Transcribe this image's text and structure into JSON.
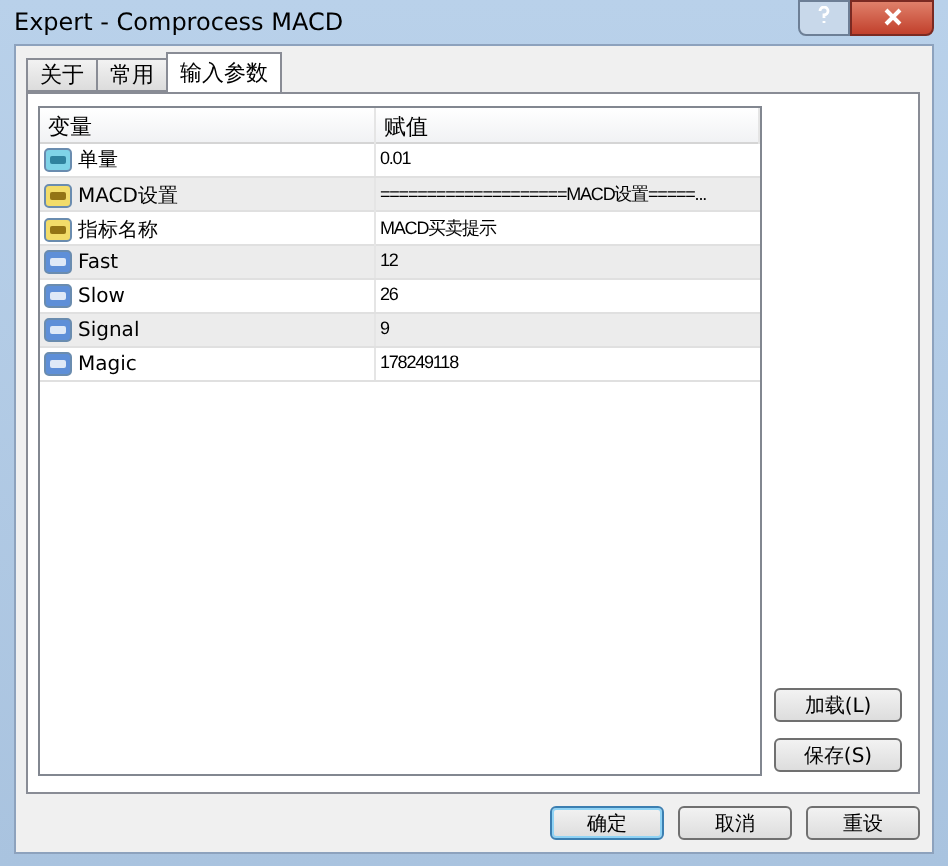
{
  "window": {
    "title": "Expert - Comprocess MACD"
  },
  "tabs": [
    {
      "label": "关于",
      "selected": false
    },
    {
      "label": "常用",
      "selected": false
    },
    {
      "label": "输入参数",
      "selected": true
    }
  ],
  "table": {
    "columns": [
      "变量",
      "赋值"
    ],
    "rows": [
      {
        "kind": "double",
        "name": "单量",
        "value": "0.01"
      },
      {
        "kind": "string",
        "name": "MACD设置",
        "value": "====================MACD设置=====..."
      },
      {
        "kind": "string",
        "name": "指标名称",
        "value": "MACD买卖提示"
      },
      {
        "kind": "int",
        "name": "Fast",
        "value": "12"
      },
      {
        "kind": "int",
        "name": "Slow",
        "value": "26"
      },
      {
        "kind": "int",
        "name": "Signal",
        "value": "9"
      },
      {
        "kind": "int",
        "name": "Magic",
        "value": "178249118"
      }
    ]
  },
  "side_buttons": [
    "加载(L)",
    "保存(S)"
  ],
  "buttons": [
    {
      "label": "确定",
      "default": true
    },
    {
      "label": "取消",
      "default": false
    },
    {
      "label": "重设",
      "default": false
    }
  ]
}
